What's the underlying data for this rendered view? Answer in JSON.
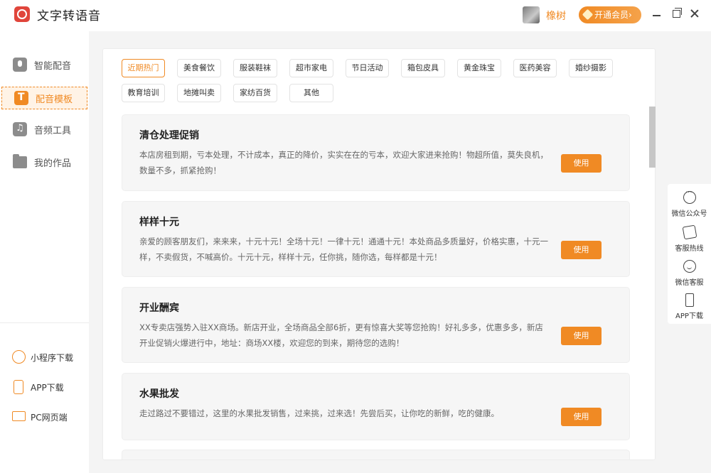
{
  "app": {
    "title": "文字转语音"
  },
  "user": {
    "name": "橡树",
    "vip_label": "开通会员"
  },
  "sidebar": {
    "items": [
      {
        "label": "智能配音",
        "icon": "mic-icon"
      },
      {
        "label": "配音模板",
        "icon": "template-icon"
      },
      {
        "label": "音频工具",
        "icon": "music-icon"
      },
      {
        "label": "我的作品",
        "icon": "folder-icon"
      }
    ],
    "bottom": [
      {
        "label": "小程序下载",
        "icon": "mini-program-icon"
      },
      {
        "label": "APP下载",
        "icon": "phone-icon"
      },
      {
        "label": "PC网页端",
        "icon": "monitor-icon"
      }
    ]
  },
  "tags": [
    "近期热门",
    "美食餐饮",
    "服装鞋袜",
    "超市家电",
    "节日活动",
    "箱包皮具",
    "黄金珠宝",
    "医药美容",
    "婚纱摄影",
    "教育培训",
    "地摊叫卖",
    "家纺百货",
    "其他"
  ],
  "cards": [
    {
      "title": "清仓处理促销",
      "desc": "本店房租到期，亏本处理，不计成本，真正的降价，实实在在的亏本，欢迎大家进来抢购！物超所值，莫失良机，数量不多，抓紧抢购！",
      "button": "使用"
    },
    {
      "title": "样样十元",
      "desc": "亲爱的顾客朋友们，来来来，十元十元！全场十元！一律十元！通通十元！本处商品多质量好，价格实惠，十元一样，不卖假货，不喊高价。十元十元，样样十元，任你挑，随你选，每样都是十元！",
      "button": "使用"
    },
    {
      "title": "开业酬宾",
      "desc": "XX专卖店强势入驻XX商场。新店开业，全场商品全部6折，更有惊喜大奖等您抢购！好礼多多，优惠多多，新店开业促销火爆进行中，地址：商场XX楼，欢迎您的到来，期待您的选购！",
      "button": "使用"
    },
    {
      "title": "水果批发",
      "desc": "走过路过不要错过，这里的水果批发销售，过来挑，过来选！先尝后买，让你吃的新鲜，吃的健康。",
      "button": "使用"
    }
  ],
  "float_bar": [
    {
      "label": "微信公众号",
      "icon": "wechat-official-icon"
    },
    {
      "label": "客服热线",
      "icon": "phone-call-icon"
    },
    {
      "label": "微信客服",
      "icon": "wechat-service-icon"
    },
    {
      "label": "APP下载",
      "icon": "mobile-icon"
    }
  ],
  "colors": {
    "accent": "#f08a24",
    "logo": "#e0453b"
  }
}
